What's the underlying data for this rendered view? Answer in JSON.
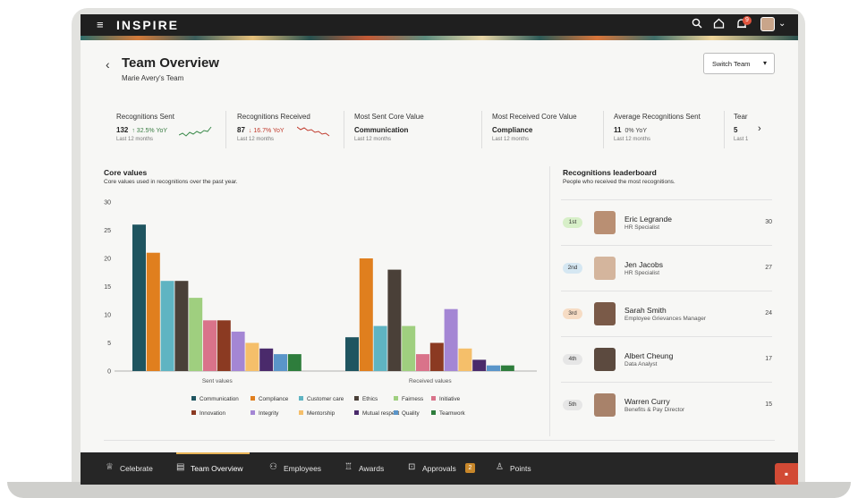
{
  "app": {
    "brand": "INSPIRE",
    "notification_count": "9"
  },
  "header": {
    "back_icon": "chevron-left-icon",
    "title": "Team Overview",
    "subtitle": "Marie Avery's Team",
    "switch_team_label": "Switch Team"
  },
  "metrics": [
    {
      "label": "Recognitions Sent",
      "value": "132",
      "change": "↑ 32.5% YoY",
      "trend": "up",
      "period": "Last 12 months"
    },
    {
      "label": "Recognitions Received",
      "value": "87",
      "change": "↓ 16.7% YoY",
      "trend": "down",
      "period": "Last 12 months"
    },
    {
      "label": "Most Sent Core Value",
      "value": "Communication",
      "change": "",
      "period": "Last 12 months"
    },
    {
      "label": "Most Received Core Value",
      "value": "Compliance",
      "change": "",
      "period": "Last 12 months"
    },
    {
      "label": "Average Recognitions Sent",
      "value": "11",
      "change": "0% YoY",
      "trend": "flat",
      "period": "Last 12 months"
    },
    {
      "label": "Tear",
      "value": "5",
      "change": "",
      "period": "Last 1"
    }
  ],
  "core_values": {
    "title": "Core values",
    "subtitle": "Core values used in recognitions over the past year."
  },
  "chart_data": {
    "type": "bar",
    "categories": [
      "Sent values",
      "Received values"
    ],
    "ylim": [
      0,
      30
    ],
    "yticks": [
      0,
      5,
      10,
      15,
      20,
      25,
      30
    ],
    "legend_position": "bottom",
    "grid": false,
    "series": [
      {
        "name": "Communication",
        "color": "#1f5560",
        "values": [
          26,
          6
        ]
      },
      {
        "name": "Compliance",
        "color": "#e07f1e",
        "values": [
          21,
          20
        ]
      },
      {
        "name": "Customer care",
        "color": "#5fb4c2",
        "values": [
          16,
          8
        ]
      },
      {
        "name": "Ethics",
        "color": "#4a4038",
        "values": [
          16,
          18
        ]
      },
      {
        "name": "Fairness",
        "color": "#9fcf7f",
        "values": [
          13,
          8
        ]
      },
      {
        "name": "Initiative",
        "color": "#d9738a",
        "values": [
          9,
          3
        ]
      },
      {
        "name": "Innovation",
        "color": "#8b3a22",
        "values": [
          9,
          5
        ]
      },
      {
        "name": "Integrity",
        "color": "#a486d4",
        "values": [
          7,
          11
        ]
      },
      {
        "name": "Mentorship",
        "color": "#f5bf6a",
        "values": [
          5,
          4
        ]
      },
      {
        "name": "Mutual respect",
        "color": "#4a2a6b",
        "values": [
          4,
          2
        ]
      },
      {
        "name": "Quality",
        "color": "#5a95c9",
        "values": [
          3,
          1
        ]
      },
      {
        "name": "Teamwork",
        "color": "#2e7d3c",
        "values": [
          3,
          1
        ]
      }
    ]
  },
  "leaderboard": {
    "title": "Recognitions leaderboard",
    "subtitle": "People who received the most recognitions.",
    "entries": [
      {
        "rank": "1st",
        "rank_color": "#d7efc8",
        "name": "Eric Legrande",
        "role": "HR Specialist",
        "count": "30",
        "avatar_color": "#b98f73"
      },
      {
        "rank": "2nd",
        "rank_color": "#d5e7f2",
        "name": "Jen Jacobs",
        "role": "HR Specialist",
        "count": "27",
        "avatar_color": "#d4b59d"
      },
      {
        "rank": "3rd",
        "rank_color": "#f6dcc4",
        "name": "Sarah Smith",
        "role": "Employee Grievances Manager",
        "count": "24",
        "avatar_color": "#7a5a48"
      },
      {
        "rank": "4th",
        "rank_color": "#e6e6e6",
        "name": "Albert Cheung",
        "role": "Data Analyst",
        "count": "17",
        "avatar_color": "#5c4a3f"
      },
      {
        "rank": "5th",
        "rank_color": "#e6e6e6",
        "name": "Warren Curry",
        "role": "Benefits & Pay Director",
        "count": "15",
        "avatar_color": "#a8826a"
      }
    ]
  },
  "bottom_nav": [
    {
      "label": "Celebrate",
      "icon": "medal-icon",
      "glyph": "♕"
    },
    {
      "label": "Team Overview",
      "icon": "id-card-icon",
      "glyph": "▤"
    },
    {
      "label": "Employees",
      "icon": "people-icon",
      "glyph": "⚇"
    },
    {
      "label": "Awards",
      "icon": "trophy-icon",
      "glyph": "♖"
    },
    {
      "label": "Approvals",
      "icon": "book-icon",
      "glyph": "⊡",
      "badge": "2"
    },
    {
      "label": "Points",
      "icon": "bag-icon",
      "glyph": "♙"
    }
  ]
}
